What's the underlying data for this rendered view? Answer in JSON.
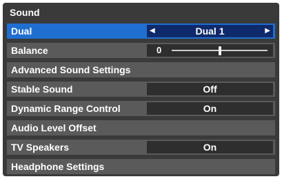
{
  "title": "Sound",
  "items": [
    {
      "label": "Dual",
      "value": "Dual 1",
      "selected": true,
      "type": "select",
      "left_arrow": "◀",
      "right_arrow": "▶"
    },
    {
      "label": "Balance",
      "type": "slider",
      "slider_value": "0",
      "slider_fraction": 0.5
    },
    {
      "label": "Advanced Sound Settings",
      "type": "link"
    },
    {
      "label": "Stable Sound",
      "value": "Off",
      "type": "select"
    },
    {
      "label": "Dynamic Range Control",
      "value": "On",
      "type": "select"
    },
    {
      "label": "Audio Level Offset",
      "type": "link"
    },
    {
      "label": "TV Speakers",
      "value": "On",
      "type": "select"
    },
    {
      "label": "Headphone Settings",
      "type": "link"
    }
  ],
  "colors": {
    "panel_bg": "#3a3a3a",
    "row_bg": "#5a5a5a",
    "value_bg": "#2e2e2e",
    "selected_row": "#1f6fd1",
    "selected_value": "#0f2a6b"
  }
}
